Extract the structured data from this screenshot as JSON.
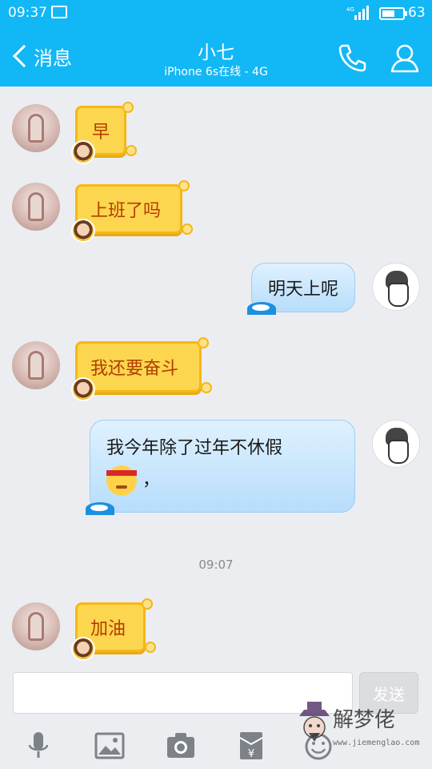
{
  "status": {
    "time": "09:37",
    "network": "4G",
    "battery": "63",
    "battery_level": 0.63
  },
  "header": {
    "back_label": "消息",
    "contact_name": "小七",
    "contact_status": "iPhone 6s在线 - 4G"
  },
  "messages": [
    {
      "side": "left",
      "text": "早"
    },
    {
      "side": "left",
      "text": "上班了吗"
    },
    {
      "side": "right",
      "text": "明天上呢"
    },
    {
      "side": "left",
      "text": "我还要奋斗"
    },
    {
      "side": "right",
      "text": "我今年除了过年不休假",
      "tail": "，"
    },
    {
      "side": "left",
      "text": "加油"
    }
  ],
  "timestamp": "09:07",
  "input": {
    "placeholder": "",
    "send_label": "发送"
  },
  "toolbar": [
    "microphone-icon",
    "image-icon",
    "camera-icon",
    "red-packet-icon",
    "emoji-icon"
  ],
  "watermark": {
    "text": "解梦佬",
    "url": "www.jiemenglao.com"
  },
  "colors": {
    "header": "#12b7f5",
    "background": "#ebedf0",
    "honey_bubble": "#fdd64f",
    "blue_bubble": "#cfe9fd"
  }
}
